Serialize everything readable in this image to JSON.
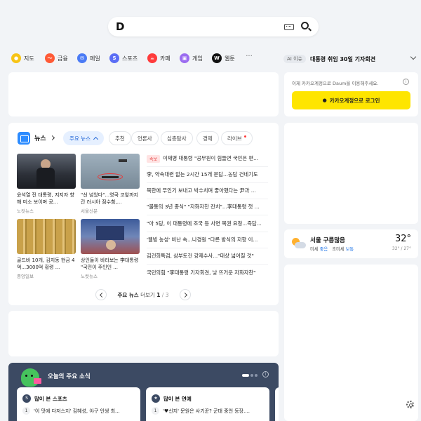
{
  "search": {
    "logo": "D",
    "placeholder": ""
  },
  "shortcuts": [
    {
      "label": "지도",
      "color": "#f7c416",
      "glyph": "●"
    },
    {
      "label": "금융",
      "color": "#ff5a36",
      "glyph": "〜"
    },
    {
      "label": "메일",
      "color": "#4b7bf5",
      "glyph": "✉"
    },
    {
      "label": "스포츠",
      "color": "#5b6ef5",
      "glyph": "S"
    },
    {
      "label": "카페",
      "color": "#ff3b3b",
      "glyph": "☕"
    },
    {
      "label": "게임",
      "color": "#9b6cf0",
      "glyph": "▣"
    },
    {
      "label": "웹툰",
      "color": "#111111",
      "glyph": "W"
    }
  ],
  "more": "···",
  "ai_issue": {
    "badge": "AI 이슈",
    "text": "대통령 취임 30일 기자회견"
  },
  "login": {
    "message": "이제 카카오계정으로 Daum을 이용해주세요.",
    "button": "카카오계정으로 로그인"
  },
  "news": {
    "title": "뉴스",
    "tabs": [
      {
        "label": "주요 뉴스",
        "active": true
      },
      {
        "label": "추천"
      },
      {
        "label": "언론사"
      },
      {
        "label": "심층탐사"
      },
      {
        "label": "경제"
      },
      {
        "label": "라이브",
        "dot": true
      }
    ],
    "thumbs": [
      {
        "caption": "윤석열 전 대통령, 지지자 향해 미소 보이며 공...",
        "source": "노컷뉴스"
      },
      {
        "caption": "\"선 넘었다\"...영국 코앞까지 간 러시아 잠수함,...",
        "source": "서울신문"
      },
      {
        "caption": "골드바 10개, 김지동 현금 4억...3000억 횡령 ...",
        "source": "중앙일보"
      },
      {
        "caption": "상인들이 바라보는 李대통령 \"국민이 주인인 ...",
        "source": "노컷뉴스"
      }
    ],
    "headlines": [
      {
        "badge": "속보",
        "text": "이재명 대통령 \"공무원이 힘들면 국민은 편..."
      },
      {
        "text": "李, 약속대련 없는 2시간 15개 문답...농담 건네기도"
      },
      {
        "text": "북한에 무인기 보내고 박수치며 좋아했다는 尹과 ..."
      },
      {
        "text": "\"불통의 3년 종식\" \"자화자찬 잔치\"...李대통령 첫 ..."
      },
      {
        "text": "\"아 5당, 이 대통령에 조국 등 사면 복권 요청...즉답..."
      },
      {
        "text": "'웰빙 농성' 비난 속...나경원 \"다른 방식의 저항 이..."
      },
      {
        "text": "김건희특검, 삼부토건 강제수사...\"대상 넓어질 것\""
      },
      {
        "text": "국민의힘 \"李대통령 기자회견, 낯 뜨거운 자화자찬\""
      }
    ],
    "pager": {
      "label": "주요 뉴스",
      "more": "더보기",
      "current": "1",
      "sep": "/",
      "total": "3"
    }
  },
  "weather": {
    "title": "서울 구름많음",
    "dust_label": "미세",
    "dust_value": "좋음",
    "fine_dust_label": "초미세",
    "fine_dust_value": "보통",
    "temp": "32°",
    "range": "32° / 27°"
  },
  "today": {
    "title": "오늘의 주요 소식",
    "cards": [
      {
        "title": "많이 본 스포츠",
        "icon": "S",
        "item_num": "1",
        "item": "'이 맛에 다저스지' 김혜성, 야구 인생 최..."
      },
      {
        "title": "많이 본 연예",
        "icon": "★",
        "item_num": "1",
        "item": "'♥신지' 문원은 사기꾼? 군대 중언 등장...."
      }
    ]
  }
}
